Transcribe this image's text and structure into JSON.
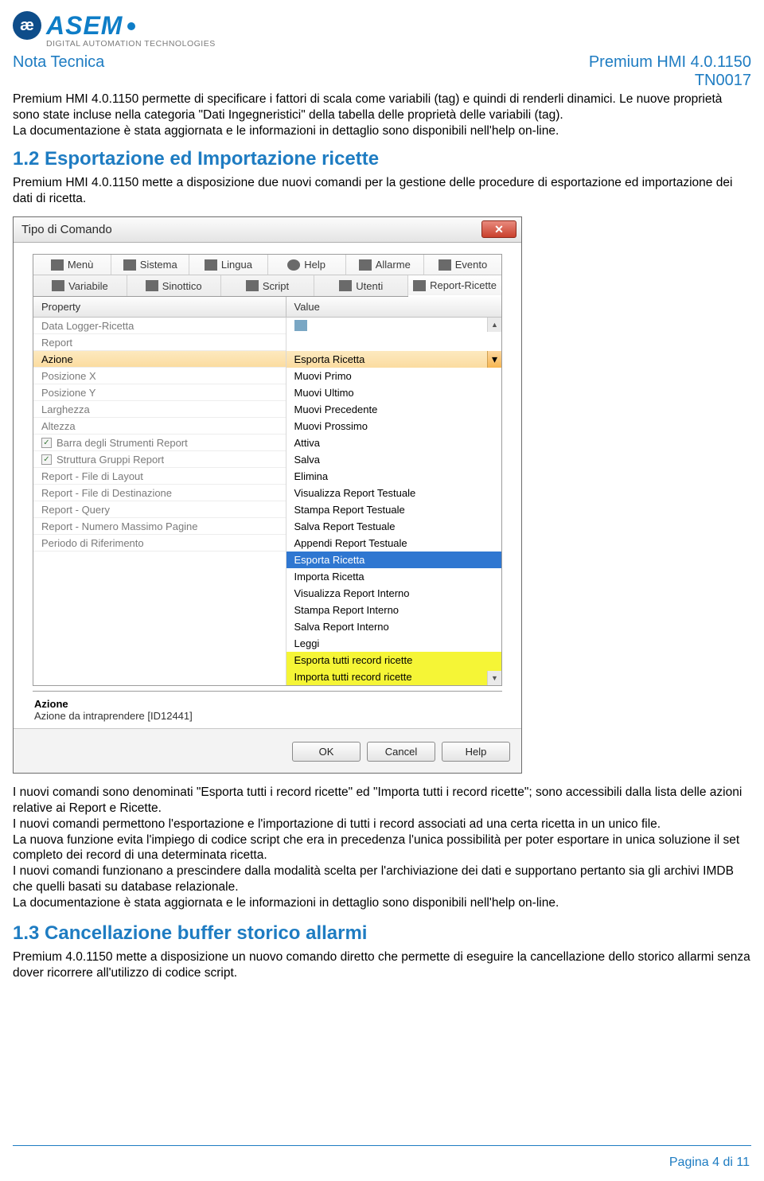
{
  "logo": {
    "badge": "æ",
    "name": "ASEM",
    "tagline": "DIGITAL AUTOMATION TECHNOLOGIES"
  },
  "header": {
    "left": "Nota Tecnica",
    "right1": "Premium HMI 4.0.1150",
    "right2": "TN0017"
  },
  "para1": "Premium HMI 4.0.1150 permette di specificare i fattori di scala come variabili (tag) e quindi di renderli dinamici. Le nuove proprietà sono state incluse nella categoria \"Dati Ingegneristici\" della tabella delle proprietà delle variabili (tag).",
  "para1b": "La documentazione è stata aggiornata e le informazioni in dettaglio sono disponibili nell'help on-line.",
  "sec12": "1.2  Esportazione ed Importazione ricette",
  "para2": "Premium HMI 4.0.1150 mette a disposizione due nuovi comandi per la gestione delle procedure di esportazione ed importazione dei dati di ricetta.",
  "dialog": {
    "title": "Tipo di Comando",
    "tabs_row1": [
      "Menù",
      "Sistema",
      "Lingua",
      "Help",
      "Allarme",
      "Evento"
    ],
    "tabs_row2": [
      "Variabile",
      "Sinottico",
      "Script",
      "Utenti",
      "Report-Ricette"
    ],
    "active_tab": "Report-Ricette",
    "headers": {
      "c1": "Property",
      "c2": "Value"
    },
    "props": [
      {
        "label": "Data Logger-Ricetta"
      },
      {
        "label": "Report"
      },
      {
        "label": "Azione",
        "selected": true
      },
      {
        "label": "Posizione X"
      },
      {
        "label": "Posizione Y"
      },
      {
        "label": "Larghezza"
      },
      {
        "label": "Altezza"
      },
      {
        "label": "Barra degli Strumenti Report",
        "checked": true
      },
      {
        "label": "Struttura Gruppi Report",
        "checked": true
      },
      {
        "label": "Report - File di Layout"
      },
      {
        "label": "Report - File di Destinazione"
      },
      {
        "label": "Report - Query"
      },
      {
        "label": "Report - Numero Massimo Pagine"
      },
      {
        "label": "Periodo di Riferimento"
      }
    ],
    "values_top": [
      {
        "label": "",
        "icon": true
      },
      {
        "label": ""
      }
    ],
    "selected_value": "Esporta Ricetta",
    "dropdown": [
      "Muovi Primo",
      "Muovi Ultimo",
      "Muovi Precedente",
      "Muovi Prossimo",
      "Attiva",
      "Salva",
      "Elimina",
      "Visualizza Report Testuale",
      "Stampa Report Testuale",
      "Salva Report Testuale",
      "Appendi Report Testuale",
      {
        "label": "Esporta Ricetta",
        "sel": true
      },
      "Importa Ricetta",
      "Visualizza Report Interno",
      "Stampa Report Interno",
      "Salva Report Interno",
      "Leggi",
      {
        "label": "Esporta tutti record ricette",
        "hl": true
      },
      {
        "label": "Importa tutti record ricette",
        "hl": true
      }
    ],
    "info": {
      "title": "Azione",
      "desc": "Azione da intraprendere [ID12441]"
    },
    "buttons": {
      "ok": "OK",
      "cancel": "Cancel",
      "help": "Help"
    }
  },
  "para3a": "I nuovi comandi sono denominati \"Esporta tutti i record ricette\" ed \"Importa tutti i record ricette\"; sono accessibili dalla lista delle azioni relative ai Report e Ricette.",
  "para3b": "I nuovi comandi permettono l'esportazione e l'importazione di tutti i record associati ad una certa ricetta in un unico file.",
  "para3c": "La nuova funzione evita l'impiego di codice script che era in precedenza l'unica possibilità per poter esportare in unica soluzione il set completo dei record di una determinata ricetta.",
  "para3d": "I nuovi comandi funzionano a prescindere dalla modalità scelta per l'archiviazione dei dati e supportano pertanto sia gli archivi IMDB che quelli basati su database relazionale.",
  "para3e": "La documentazione è stata aggiornata e le informazioni in dettaglio sono disponibili nell'help on-line.",
  "sec13": "1.3  Cancellazione buffer storico allarmi",
  "para4": "Premium 4.0.1150 mette a disposizione un nuovo comando diretto che permette di eseguire la cancellazione dello storico allarmi senza dover ricorrere all'utilizzo di codice script.",
  "footer": "Pagina 4 di 11"
}
